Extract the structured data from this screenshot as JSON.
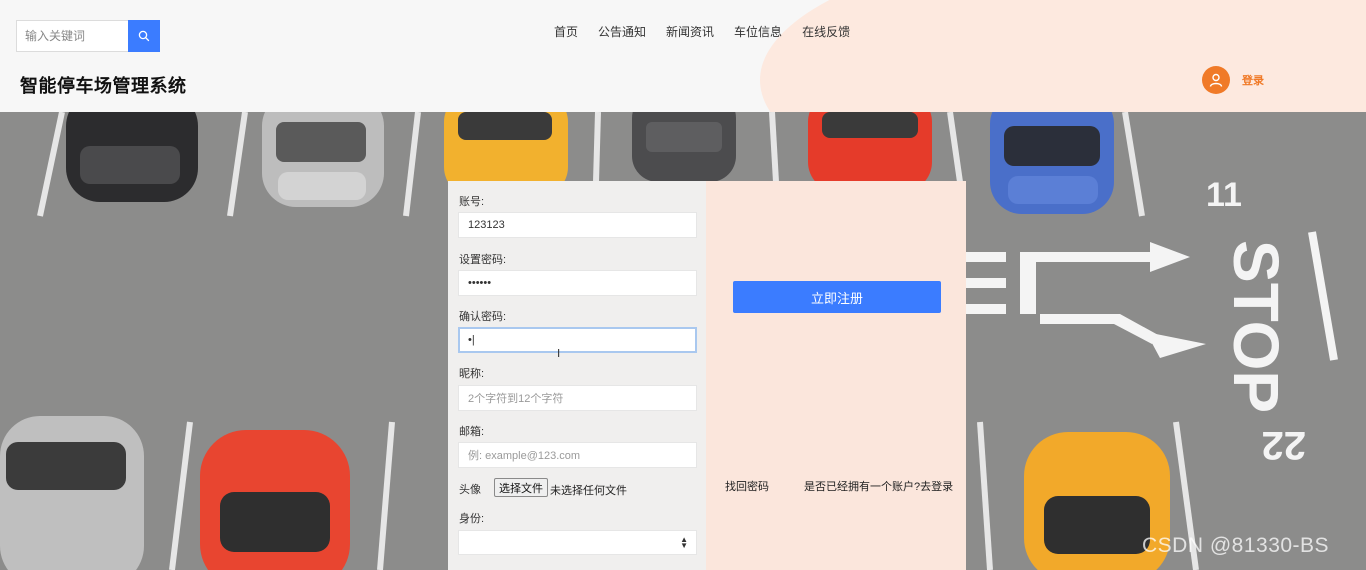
{
  "search": {
    "placeholder": "输入关键词"
  },
  "nav": {
    "items": [
      "首页",
      "公告通知",
      "新闻资讯",
      "车位信息",
      "在线反馈"
    ]
  },
  "site": {
    "title": "智能停车场管理系统"
  },
  "user": {
    "login_label": "登录"
  },
  "scene": {
    "marking_11": "11",
    "marking_stop": "STOP",
    "marking_22": "22"
  },
  "form": {
    "account_label": "账号:",
    "account_value": "123123",
    "password_label": "设置密码:",
    "password_value": "••••••",
    "confirm_label": "确认密码:",
    "confirm_value": "•|",
    "nickname_label": "昵称:",
    "nickname_placeholder": "2个字符到12个字符",
    "email_label": "邮箱:",
    "email_placeholder": "例: example@123.com",
    "avatar_label": "头像",
    "file_button": "选择文件",
    "file_status": "未选择任何文件",
    "identity_label": "身份:",
    "identity_value": "",
    "submit_label": "立即注册",
    "forgot_link": "找回密码",
    "have_account_link": "是否已经拥有一个账户?去登录"
  },
  "watermark": "CSDN @81330-BS",
  "colors": {
    "accent": "#3b7cff",
    "brand_orange": "#f07a28",
    "panel_peach": "#fbe6dc"
  }
}
